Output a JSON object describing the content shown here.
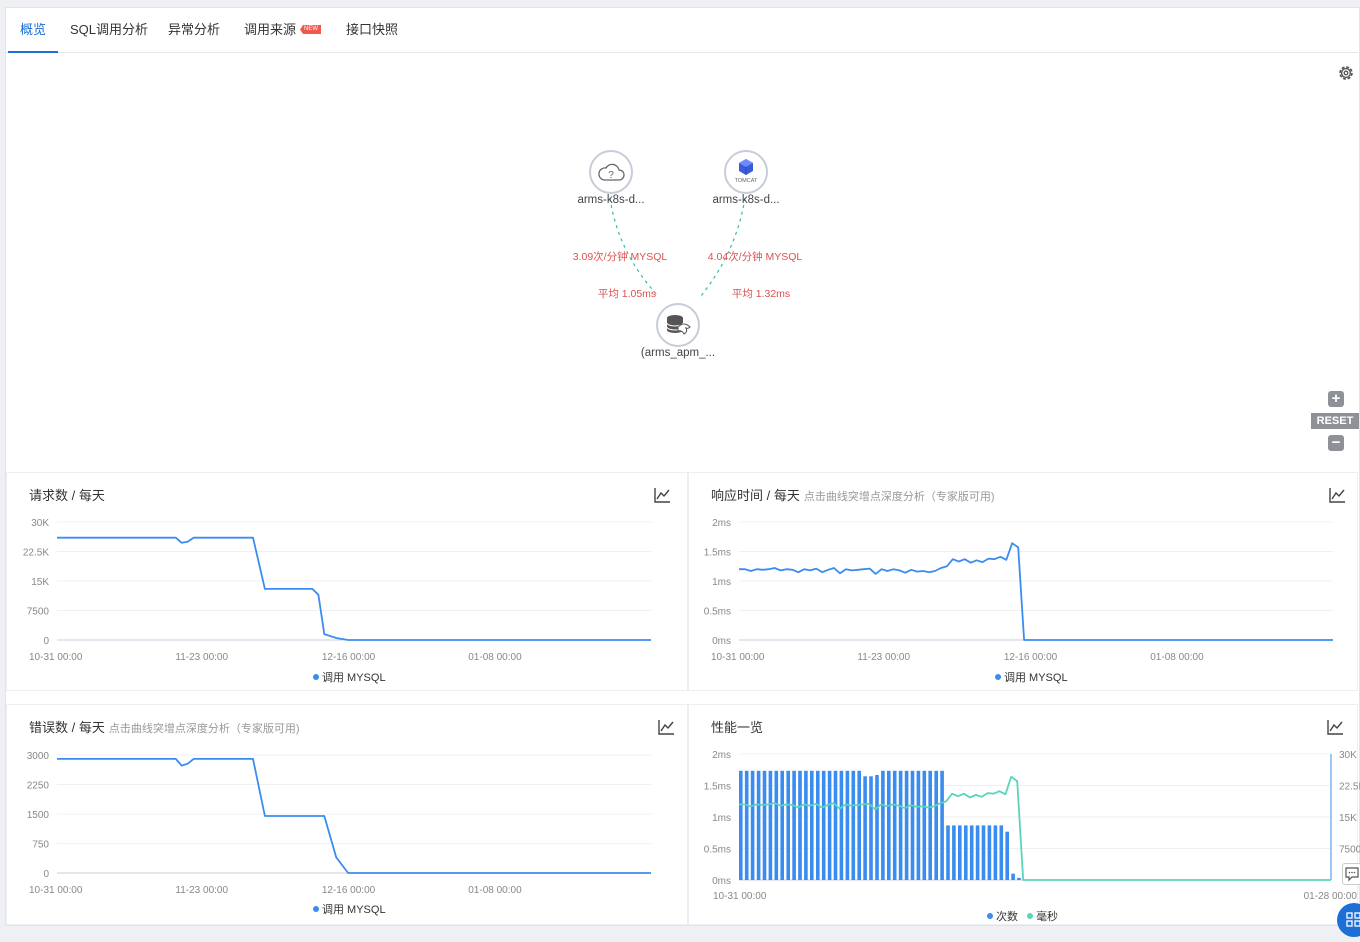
{
  "tabs": [
    {
      "label": "概览",
      "active": true
    },
    {
      "label": "SQL调用分析",
      "active": false
    },
    {
      "label": "异常分析",
      "active": false
    },
    {
      "label": "调用来源",
      "active": false,
      "badge": "NEW"
    },
    {
      "label": "接口快照",
      "active": false
    }
  ],
  "topology": {
    "nodes": [
      {
        "label": "arms-k8s-d...",
        "icon": "cloud-question-icon"
      },
      {
        "label": "arms-k8s-d...",
        "icon": "tomcat-cube-icon",
        "icon_text": "TOMCAT"
      },
      {
        "label": "(arms_apm_...",
        "icon": "mysql-database-icon"
      }
    ],
    "edges": [
      {
        "rate": "3.09次/分钟 MYSQL",
        "avg": "平均 1.05ms"
      },
      {
        "rate": "4.04次/分钟 MYSQL",
        "avg": "平均 1.32ms"
      }
    ],
    "controls": {
      "zoom_in": "+",
      "reset": "RESET",
      "zoom_out": "−"
    },
    "colors": {
      "edge": "#3cba9f",
      "label": "#d9534f"
    }
  },
  "panels": {
    "requests": {
      "title": "请求数 / 每天",
      "subtitle": ""
    },
    "response": {
      "title": "响应时间 / 每天",
      "subtitle": "点击曲线突增点深度分析（专家版可用)"
    },
    "errors": {
      "title": "错误数 / 每天",
      "subtitle": "点击曲线突增点深度分析（专家版可用)"
    },
    "performance": {
      "title": "性能一览",
      "subtitle": ""
    }
  },
  "chart_data": [
    {
      "type": "line",
      "title": "请求数 / 每天",
      "x_ticks": [
        "10-31 00:00",
        "11-23 00:00",
        "12-16 00:00",
        "01-08 00:00"
      ],
      "y_ticks": [
        "30K",
        "22.5K",
        "15K",
        "7500",
        "0"
      ],
      "ylim": [
        0,
        30000
      ],
      "legend": "调用 MYSQL",
      "color": "#3b8cf0",
      "x": [
        0,
        20,
        21,
        22,
        23,
        33,
        35,
        43,
        44,
        45,
        47,
        49,
        50,
        100
      ],
      "series": [
        {
          "name": "调用 MYSQL",
          "values": [
            26000,
            26000,
            24700,
            25000,
            26000,
            26000,
            13000,
            13000,
            11500,
            1500,
            500,
            0,
            0,
            0
          ]
        }
      ]
    },
    {
      "type": "line",
      "title": "响应时间 / 每天",
      "x_ticks": [
        "10-31 00:00",
        "11-23 00:00",
        "12-16 00:00",
        "01-08 00:00"
      ],
      "y_ticks": [
        "2ms",
        "1.5ms",
        "1ms",
        "0.5ms",
        "0ms"
      ],
      "ylim": [
        0,
        2
      ],
      "legend": "调用 MYSQL",
      "color": "#3b8cf0",
      "x": [
        0,
        1,
        2,
        3,
        4,
        5,
        6,
        7,
        8,
        9,
        10,
        11,
        12,
        13,
        14,
        15,
        16,
        17,
        18,
        19,
        20,
        21,
        22,
        23,
        24,
        25,
        26,
        27,
        28,
        29,
        30,
        31,
        32,
        33,
        34,
        35,
        36,
        37,
        38,
        39,
        40,
        41,
        42,
        43,
        44,
        45,
        46,
        47,
        48,
        49,
        50,
        100
      ],
      "series": [
        {
          "name": "调用 MYSQL",
          "values": [
            1.2,
            1.2,
            1.17,
            1.2,
            1.19,
            1.2,
            1.22,
            1.18,
            1.2,
            1.19,
            1.15,
            1.2,
            1.18,
            1.21,
            1.15,
            1.19,
            1.22,
            1.13,
            1.2,
            1.18,
            1.19,
            1.2,
            1.21,
            1.12,
            1.2,
            1.17,
            1.2,
            1.18,
            1.14,
            1.19,
            1.16,
            1.17,
            1.15,
            1.17,
            1.22,
            1.25,
            1.37,
            1.33,
            1.37,
            1.31,
            1.35,
            1.32,
            1.38,
            1.37,
            1.41,
            1.36,
            1.64,
            1.57,
            0,
            0,
            0,
            0
          ]
        }
      ]
    },
    {
      "type": "line",
      "title": "错误数 / 每天",
      "x_ticks": [
        "10-31 00:00",
        "11-23 00:00",
        "12-16 00:00",
        "01-08 00:00"
      ],
      "y_ticks": [
        "3000",
        "2250",
        "1500",
        "750",
        "0"
      ],
      "ylim": [
        0,
        3000
      ],
      "legend": "调用 MYSQL",
      "color": "#3b8cf0",
      "x": [
        0,
        20,
        21,
        22,
        23,
        33,
        35,
        45,
        47,
        49,
        100
      ],
      "series": [
        {
          "name": "调用 MYSQL",
          "values": [
            2900,
            2900,
            2730,
            2780,
            2900,
            2900,
            1450,
            1450,
            400,
            0,
            0
          ]
        }
      ]
    },
    {
      "type": "bar",
      "title": "性能一览",
      "x_ticks": [
        "10-31 00:00",
        "01-28 00:00"
      ],
      "y_ticks_left": [
        "2ms",
        "1.5ms",
        "1ms",
        "0.5ms",
        "0ms"
      ],
      "y_ticks_right": [
        "30K",
        "22.5K",
        "15K",
        "7500",
        ""
      ],
      "ylim_left": [
        0,
        2
      ],
      "ylim_right": [
        0,
        30000
      ],
      "legend": [
        {
          "name": "次数",
          "color": "#3b8cf0"
        },
        {
          "name": "毫秒",
          "color": "#5bd4b8"
        }
      ],
      "series": [
        {
          "name": "次数",
          "values": [
            26000,
            26000,
            26000,
            26000,
            26000,
            26000,
            26000,
            26000,
            26000,
            26000,
            26000,
            26000,
            26000,
            26000,
            26000,
            26000,
            26000,
            26000,
            26000,
            26000,
            26000,
            24700,
            24700,
            25000,
            26000,
            26000,
            26000,
            26000,
            26000,
            26000,
            26000,
            26000,
            26000,
            26000,
            26000,
            13000,
            13000,
            13000,
            13000,
            13000,
            13000,
            13000,
            13000,
            13000,
            13000,
            11500,
            1500,
            500,
            0,
            0,
            0,
            0,
            0,
            0,
            0,
            0,
            0,
            0,
            0,
            0,
            0,
            0,
            0,
            0,
            0,
            0,
            0,
            0,
            0,
            0,
            0,
            0,
            0,
            0,
            0,
            0,
            0,
            0,
            0,
            0,
            0,
            0,
            0,
            0,
            0,
            0,
            0,
            0,
            0,
            0,
            0,
            0,
            0,
            0,
            0,
            0,
            0,
            0,
            0,
            0
          ]
        },
        {
          "name": "毫秒",
          "x": [
            0,
            1,
            2,
            3,
            4,
            5,
            6,
            7,
            8,
            9,
            10,
            11,
            12,
            13,
            14,
            15,
            16,
            17,
            18,
            19,
            20,
            21,
            22,
            23,
            24,
            25,
            26,
            27,
            28,
            29,
            30,
            31,
            32,
            33,
            34,
            35,
            36,
            37,
            38,
            39,
            40,
            41,
            42,
            43,
            44,
            45,
            46,
            47,
            48,
            49,
            50,
            100
          ],
          "values": [
            1.2,
            1.2,
            1.17,
            1.2,
            1.19,
            1.2,
            1.22,
            1.18,
            1.2,
            1.19,
            1.15,
            1.2,
            1.18,
            1.21,
            1.15,
            1.19,
            1.22,
            1.13,
            1.2,
            1.18,
            1.19,
            1.2,
            1.21,
            1.12,
            1.2,
            1.17,
            1.2,
            1.18,
            1.14,
            1.19,
            1.16,
            1.17,
            1.15,
            1.17,
            1.22,
            1.25,
            1.37,
            1.33,
            1.37,
            1.31,
            1.35,
            1.32,
            1.38,
            1.37,
            1.41,
            1.36,
            1.64,
            1.57,
            0,
            0,
            0,
            0
          ]
        }
      ]
    }
  ]
}
